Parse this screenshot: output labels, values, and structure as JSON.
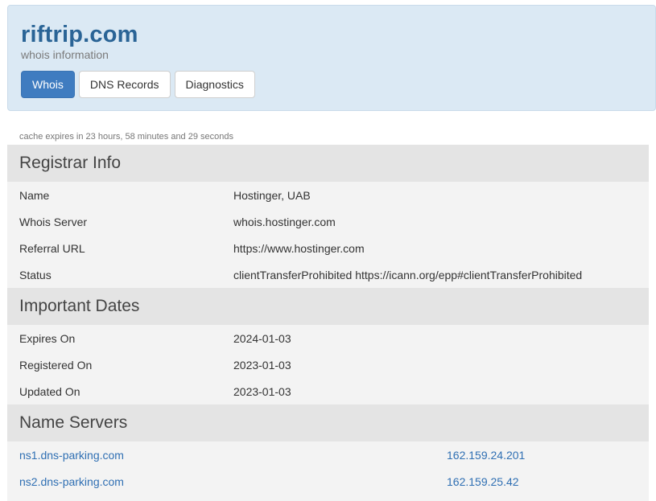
{
  "header": {
    "domain": "riftrip.com",
    "subtitle": "whois information",
    "tabs": [
      {
        "label": "Whois",
        "active": true
      },
      {
        "label": "DNS Records",
        "active": false
      },
      {
        "label": "Diagnostics",
        "active": false
      }
    ]
  },
  "cache_note": "cache expires in 23 hours, 58 minutes and 29 seconds",
  "registrar": {
    "title": "Registrar Info",
    "rows": [
      {
        "key": "Name",
        "value": "Hostinger, UAB"
      },
      {
        "key": "Whois Server",
        "value": "whois.hostinger.com"
      },
      {
        "key": "Referral URL",
        "value": "https://www.hostinger.com"
      },
      {
        "key": "Status",
        "value": "clientTransferProhibited https://icann.org/epp#clientTransferProhibited"
      }
    ]
  },
  "dates": {
    "title": "Important Dates",
    "rows": [
      {
        "key": "Expires On",
        "value": "2024-01-03"
      },
      {
        "key": "Registered On",
        "value": "2023-01-03"
      },
      {
        "key": "Updated On",
        "value": "2023-01-03"
      }
    ]
  },
  "nameservers": {
    "title": "Name Servers",
    "rows": [
      {
        "host": "ns1.dns-parking.com",
        "ip": "162.159.24.201"
      },
      {
        "host": "ns2.dns-parking.com",
        "ip": "162.159.25.42"
      }
    ]
  },
  "colors": {
    "accent": "#3f7cc0",
    "header_bg": "#dbe9f4",
    "title": "#2a6496",
    "link": "#2f6fb3"
  }
}
